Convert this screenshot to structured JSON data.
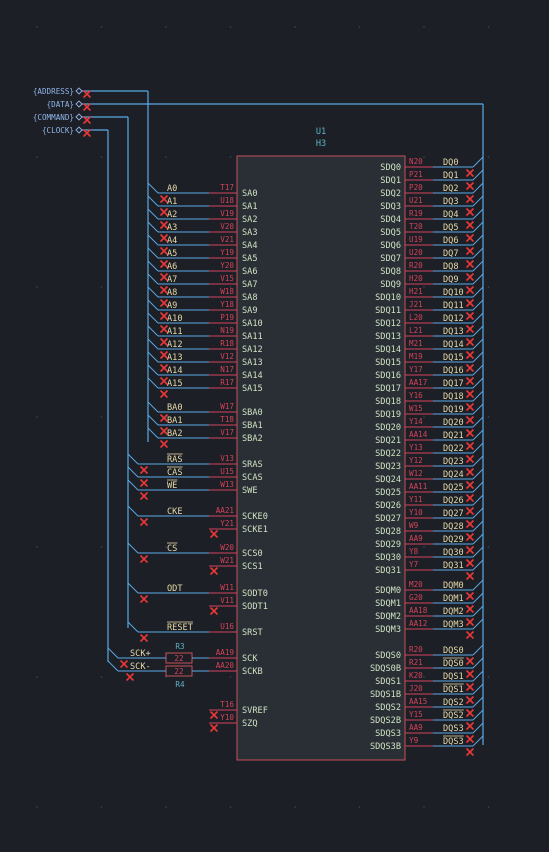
{
  "colors": {
    "background": "#1c1f25",
    "grid_dot": "#3a3f48",
    "wire": "#5aa9e6",
    "pin": "#d5435a",
    "label": "#e6d9a8",
    "pin_name": "#cfe3c3",
    "pin_number": "#d5435a",
    "body_fill": "#2a2e35",
    "body_stroke": "#c8505a",
    "ref": "#5fb3c7",
    "no_connect": "#e83838",
    "port": "#8fb4e8"
  },
  "hier_ports": [
    "{ADDRESS}",
    "{DATA}",
    "{COMMAND}",
    "{CLOCK}"
  ],
  "symbol": {
    "ref": "U1",
    "value": "H3"
  },
  "left_pins": [
    {
      "net": "A0",
      "num": "T17",
      "name": "SA0"
    },
    {
      "net": "A1",
      "num": "U18",
      "name": "SA1"
    },
    {
      "net": "A2",
      "num": "V19",
      "name": "SA2"
    },
    {
      "net": "A3",
      "num": "V20",
      "name": "SA3"
    },
    {
      "net": "A4",
      "num": "V21",
      "name": "SA4"
    },
    {
      "net": "A5",
      "num": "Y19",
      "name": "SA5"
    },
    {
      "net": "A6",
      "num": "Y20",
      "name": "SA6"
    },
    {
      "net": "A7",
      "num": "V15",
      "name": "SA7"
    },
    {
      "net": "A8",
      "num": "W18",
      "name": "SA8"
    },
    {
      "net": "A9",
      "num": "Y18",
      "name": "SA9"
    },
    {
      "net": "A10",
      "num": "P19",
      "name": "SA10"
    },
    {
      "net": "A11",
      "num": "N19",
      "name": "SA11"
    },
    {
      "net": "A12",
      "num": "R18",
      "name": "SA12"
    },
    {
      "net": "A13",
      "num": "V12",
      "name": "SA13"
    },
    {
      "net": "A14",
      "num": "N17",
      "name": "SA14"
    },
    {
      "net": "A15",
      "num": "R17",
      "name": "SA15"
    },
    {
      "net": "BA0",
      "num": "W17",
      "name": "SBA0"
    },
    {
      "net": "BA1",
      "num": "T18",
      "name": "SBA1"
    },
    {
      "net": "BA2",
      "num": "V17",
      "name": "SBA2"
    },
    {
      "net": "RAS",
      "num": "V13",
      "name": "SRAS"
    },
    {
      "net": "CAS",
      "num": "U15",
      "name": "SCAS"
    },
    {
      "net": "WE",
      "num": "W13",
      "name": "SWE"
    },
    {
      "net": "CKE",
      "num": "AA21",
      "name": "SCKE0"
    },
    {
      "net": "",
      "num": "Y21",
      "name": "SCKE1"
    },
    {
      "net": "CS",
      "num": "W20",
      "name": "SCS0"
    },
    {
      "net": "",
      "num": "W21",
      "name": "SCS1"
    },
    {
      "net": "ODT",
      "num": "W11",
      "name": "SODT0"
    },
    {
      "net": "",
      "num": "V11",
      "name": "SODT1"
    },
    {
      "net": "RESET",
      "num": "U16",
      "name": "SRST"
    },
    {
      "net": "SCK+",
      "num": "AA19",
      "name": "SCK"
    },
    {
      "net": "SCK-",
      "num": "AA20",
      "name": "SCKB"
    },
    {
      "net": "",
      "num": "T16",
      "name": "SVREF"
    },
    {
      "net": "",
      "num": "Y10",
      "name": "SZQ"
    }
  ],
  "resistors": [
    {
      "ref": "R3",
      "value": "22"
    },
    {
      "ref": "R4",
      "value": "22"
    }
  ],
  "right_pins": [
    {
      "name": "SDQ0",
      "num": "N20",
      "net": "DQ0"
    },
    {
      "name": "SDQ1",
      "num": "P21",
      "net": "DQ1"
    },
    {
      "name": "SDQ2",
      "num": "P20",
      "net": "DQ2"
    },
    {
      "name": "SDQ3",
      "num": "U21",
      "net": "DQ3"
    },
    {
      "name": "SDQ4",
      "num": "R19",
      "net": "DQ4"
    },
    {
      "name": "SDQ5",
      "num": "T20",
      "net": "DQ5"
    },
    {
      "name": "SDQ6",
      "num": "U19",
      "net": "DQ6"
    },
    {
      "name": "SDQ7",
      "num": "U20",
      "net": "DQ7"
    },
    {
      "name": "SDQ8",
      "num": "R20",
      "net": "DQ8"
    },
    {
      "name": "SDQ9",
      "num": "H20",
      "net": "DQ9"
    },
    {
      "name": "SDQ10",
      "num": "H21",
      "net": "DQ10"
    },
    {
      "name": "SDQ11",
      "num": "J21",
      "net": "DQ11"
    },
    {
      "name": "SDQ12",
      "num": "L20",
      "net": "DQ12"
    },
    {
      "name": "SDQ13",
      "num": "L21",
      "net": "DQ13"
    },
    {
      "name": "SDQ14",
      "num": "M21",
      "net": "DQ14"
    },
    {
      "name": "SDQ15",
      "num": "M19",
      "net": "DQ15"
    },
    {
      "name": "SDQ16",
      "num": "Y17",
      "net": "DQ16"
    },
    {
      "name": "SDQ17",
      "num": "AA17",
      "net": "DQ17"
    },
    {
      "name": "SDQ18",
      "num": "Y16",
      "net": "DQ18"
    },
    {
      "name": "SDQ19",
      "num": "W15",
      "net": "DQ19"
    },
    {
      "name": "SDQ20",
      "num": "Y14",
      "net": "DQ20"
    },
    {
      "name": "SDQ21",
      "num": "AA14",
      "net": "DQ21"
    },
    {
      "name": "SDQ22",
      "num": "Y13",
      "net": "DQ22"
    },
    {
      "name": "SDQ23",
      "num": "Y12",
      "net": "DQ23"
    },
    {
      "name": "SDQ24",
      "num": "W12",
      "net": "DQ24"
    },
    {
      "name": "SDQ25",
      "num": "AA11",
      "net": "DQ25"
    },
    {
      "name": "SDQ26",
      "num": "Y11",
      "net": "DQ26"
    },
    {
      "name": "SDQ27",
      "num": "Y10",
      "net": "DQ27"
    },
    {
      "name": "SDQ28",
      "num": "W9",
      "net": "DQ28"
    },
    {
      "name": "SDQ29",
      "num": "AA9",
      "net": "DQ29"
    },
    {
      "name": "SDQ30",
      "num": "Y8",
      "net": "DQ30"
    },
    {
      "name": "SDQ31",
      "num": "Y7",
      "net": "DQ31"
    },
    {
      "name": "SDQM0",
      "num": "M20",
      "net": "DQM0"
    },
    {
      "name": "SDQM1",
      "num": "G20",
      "net": "DQM1"
    },
    {
      "name": "SDQM2",
      "num": "AA18",
      "net": "DQM2"
    },
    {
      "name": "SDQM3",
      "num": "AA12",
      "net": "DQM3"
    },
    {
      "name": "SDQS0",
      "num": "R20",
      "net": "DQS0"
    },
    {
      "name": "SDQS0B",
      "num": "R21",
      "net": "DQS0"
    },
    {
      "name": "SDQS1",
      "num": "K20",
      "net": "DQS1"
    },
    {
      "name": "SDQS1B",
      "num": "J20",
      "net": "DQS1"
    },
    {
      "name": "SDQS2",
      "num": "AA15",
      "net": "DQS2"
    },
    {
      "name": "SDQS2B",
      "num": "Y15",
      "net": "DQS2"
    },
    {
      "name": "SDQS3",
      "num": "AA9",
      "net": "DQS3"
    },
    {
      "name": "SDQS3B",
      "num": "Y9",
      "net": "DQS3"
    }
  ]
}
